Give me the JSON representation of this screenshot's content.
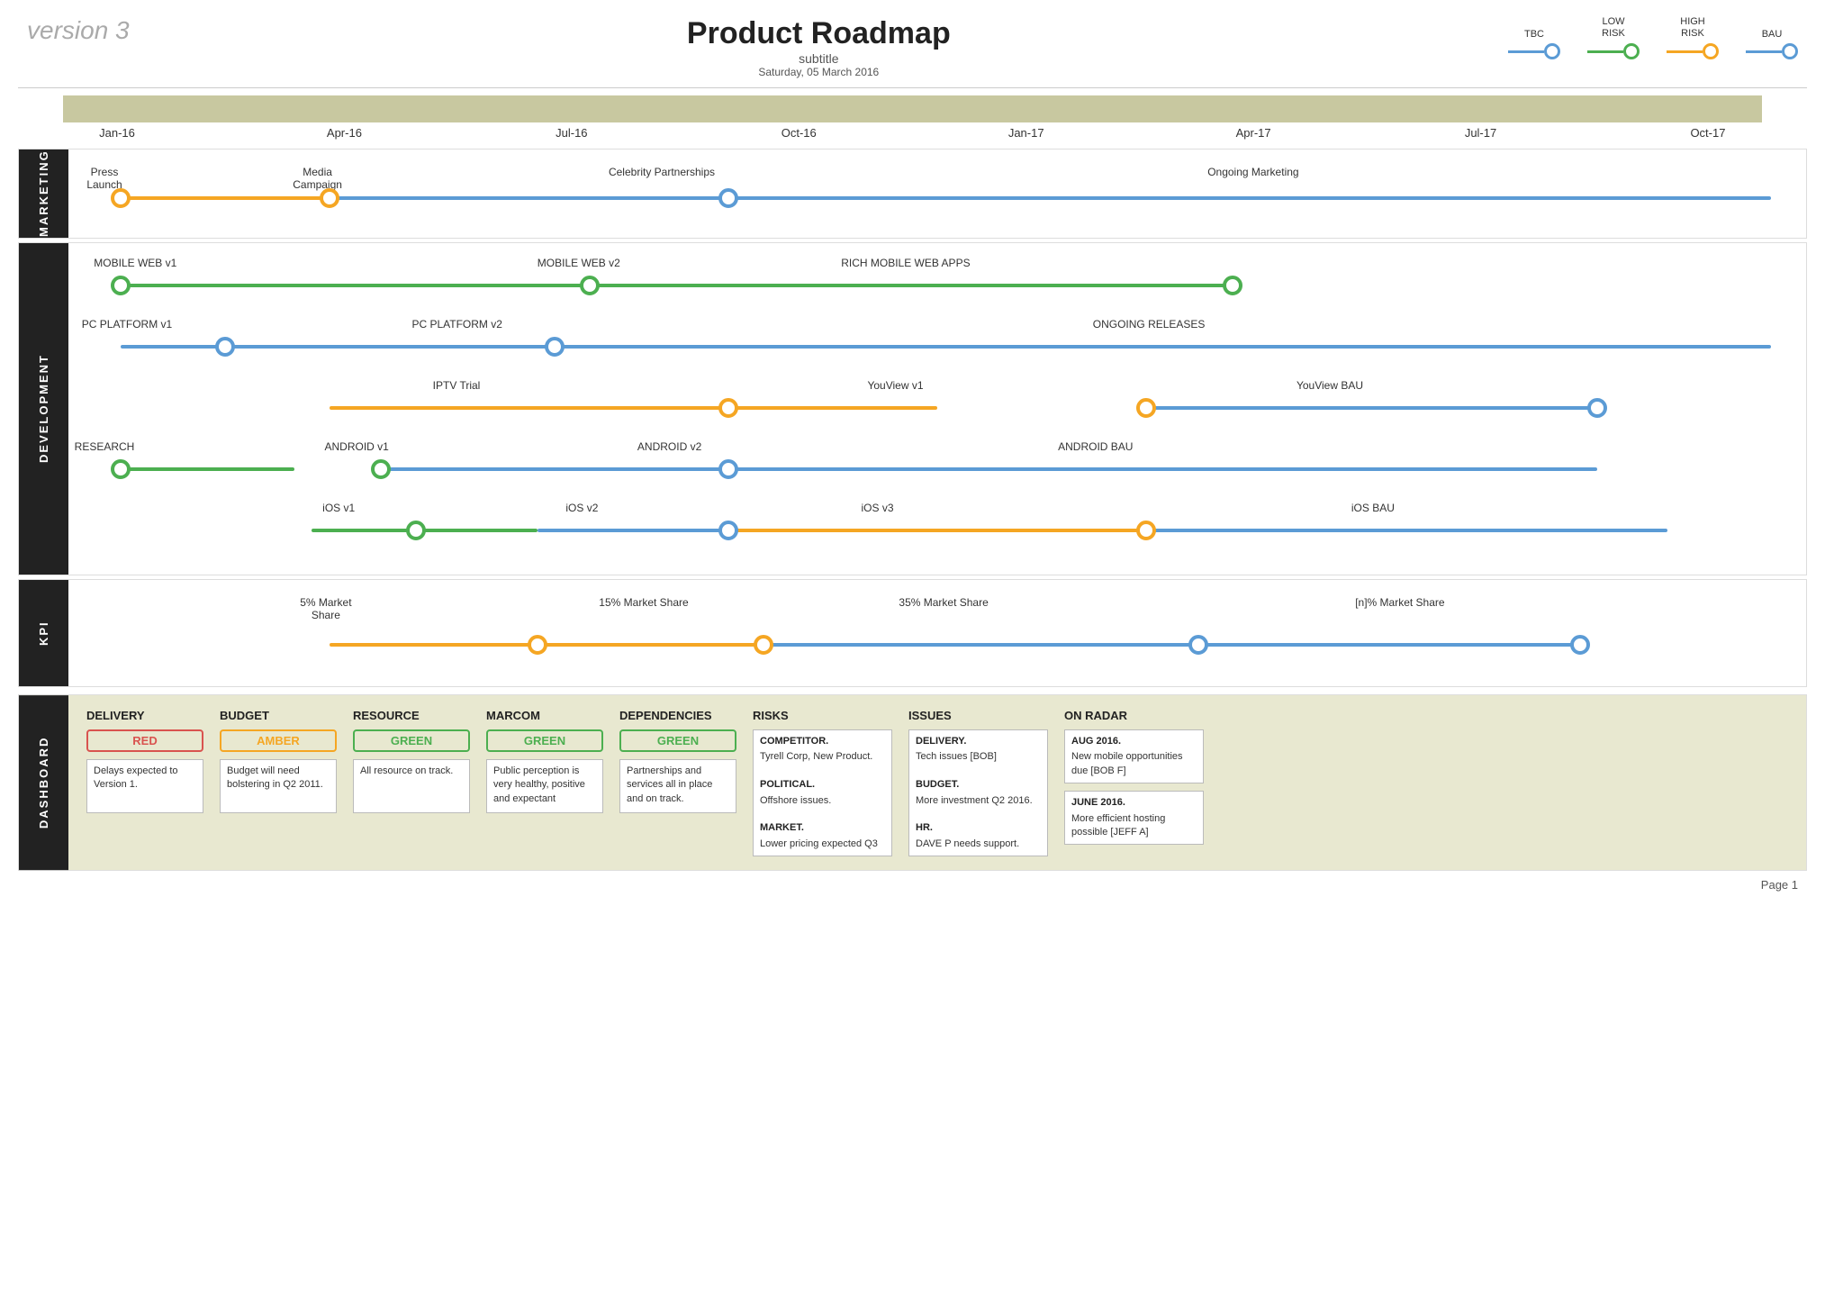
{
  "header": {
    "version": "version 3",
    "title": "Product Roadmap",
    "subtitle": "subtitle",
    "date": "Saturday, 05 March 2016"
  },
  "legend": {
    "items": [
      {
        "label": "TBC",
        "color": "#5b9bd5"
      },
      {
        "label": "LOW\nRISK",
        "color": "#4caf50"
      },
      {
        "label": "HIGH\nRISK",
        "color": "#f5a623"
      },
      {
        "label": "BAU",
        "color": "#5b9bd5"
      }
    ]
  },
  "timeline": {
    "months": [
      "Jan-16",
      "Apr-16",
      "Jul-16",
      "Oct-16",
      "Jan-17",
      "Apr-17",
      "Jul-17",
      "Oct-17"
    ]
  },
  "sections": {
    "marketing": {
      "label": "MARKETING",
      "rows": [
        {
          "label": "Press Launch",
          "label2": "Media Campaign",
          "label3": "Celebrity Partnerships",
          "label4": "Ongoing Marketing"
        }
      ]
    },
    "development": {
      "label": "DEVELOPMENT",
      "rows": [
        {
          "label": "MOBILE WEB v1",
          "label2": "MOBILE WEB v2",
          "label3": "RICH MOBILE WEB APPS"
        },
        {
          "label": "PC PLATFORM v1",
          "label2": "PC PLATFORM v2",
          "label3": "ONGOING RELEASES"
        },
        {
          "label": "IPTV Trial",
          "label2": "YouView v1",
          "label3": "YouView BAU"
        },
        {
          "label": "RESEARCH",
          "label2": "ANDROID v1",
          "label3": "ANDROID v2",
          "label4": "ANDROID BAU"
        },
        {
          "label": "iOS v1",
          "label2": "iOS v2",
          "label3": "iOS v3",
          "label4": "iOS BAU"
        }
      ]
    },
    "kpi": {
      "label": "KPI",
      "rows": [
        {
          "label": "5% Market Share",
          "label2": "15% Market Share",
          "label3": "35% Market Share",
          "label4": "[n]% Market Share"
        }
      ]
    }
  },
  "dashboard": {
    "label": "DASHBOARD",
    "delivery": {
      "title": "DELIVERY",
      "badge": "RED",
      "text": "Delays expected to Version 1."
    },
    "budget": {
      "title": "BUDGET",
      "badge": "AMBER",
      "text": "Budget will need bolstering in Q2 2011."
    },
    "resource": {
      "title": "RESOURCE",
      "badge": "GREEN",
      "text": "All resource on track."
    },
    "marcom": {
      "title": "MARCOM",
      "badge": "GREEN",
      "text": "Public perception is very healthy, positive and expectant"
    },
    "dependencies": {
      "title": "DEPENDENCIES",
      "badge": "GREEN",
      "text": "Partnerships and services all in place and on track."
    },
    "risks": {
      "title": "RISKS",
      "items": [
        {
          "head": "COMPETITOR.",
          "body": "Tyrell Corp, New Product."
        },
        {
          "head": "POLITICAL.",
          "body": "Offshore issues."
        },
        {
          "head": "MARKET.",
          "body": "Lower pricing expected Q3"
        }
      ]
    },
    "issues": {
      "title": "ISSUES",
      "items": [
        {
          "head": "DELIVERY.",
          "body": "Tech issues [BOB]"
        },
        {
          "head": "BUDGET.",
          "body": "More investment Q2 2016."
        },
        {
          "head": "HR.",
          "body": "DAVE P needs support."
        }
      ]
    },
    "onradar": {
      "title": "ON RADAR",
      "items": [
        {
          "head": "AUG 2016.",
          "body": "New mobile opportunities due [BOB F]"
        },
        {
          "head": "JUNE 2016.",
          "body": "More efficient hosting possible [JEFF A]"
        }
      ]
    }
  },
  "footer": {
    "page": "Page 1"
  }
}
